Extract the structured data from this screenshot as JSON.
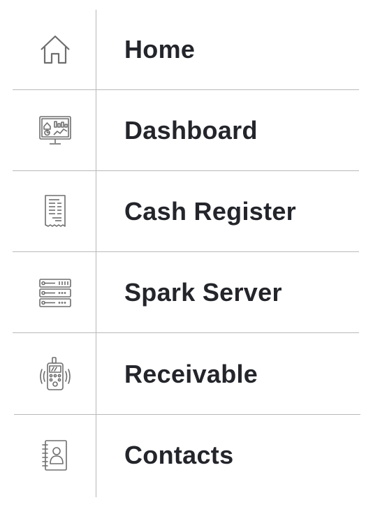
{
  "nav": {
    "items": [
      {
        "label": "Home",
        "icon": "home-icon"
      },
      {
        "label": "Dashboard",
        "icon": "dashboard-monitor-icon"
      },
      {
        "label": "Cash Register",
        "icon": "receipt-icon"
      },
      {
        "label": "Spark Server",
        "icon": "server-rack-icon"
      },
      {
        "label": "Receivable",
        "icon": "payment-terminal-icon"
      },
      {
        "label": "Contacts",
        "icon": "address-book-icon"
      }
    ]
  },
  "colors": {
    "text": "#23252b",
    "divider": "#b9b9b9",
    "icon_stroke": "#6e6e6e"
  }
}
